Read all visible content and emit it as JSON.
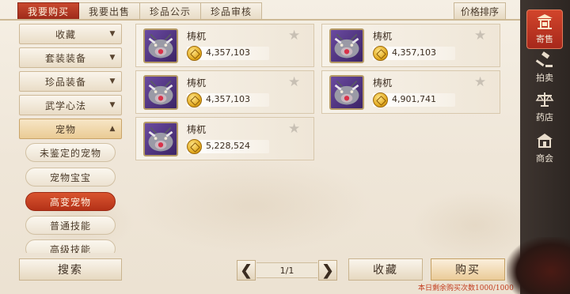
{
  "tabs": [
    {
      "label": "我要购买",
      "active": true
    },
    {
      "label": "我要出售",
      "active": false
    },
    {
      "label": "珍品公示",
      "active": false
    },
    {
      "label": "珍品审核",
      "active": false
    }
  ],
  "sort_label": "价格排序",
  "sidebar": {
    "categories": [
      {
        "label": "收藏",
        "expanded": false
      },
      {
        "label": "套装装备",
        "expanded": false
      },
      {
        "label": "珍品装备",
        "expanded": false
      },
      {
        "label": "武学心法",
        "expanded": false
      },
      {
        "label": "宠物",
        "expanded": true
      }
    ],
    "subcategories": [
      {
        "label": "未鉴定的宠物",
        "active": false
      },
      {
        "label": "宠物宝宝",
        "active": false
      },
      {
        "label": "高变宠物",
        "active": true
      },
      {
        "label": "普通技能",
        "active": false
      },
      {
        "label": "高级技能",
        "active": false
      }
    ]
  },
  "items": [
    {
      "name": "梼杌",
      "price": "4,357,103"
    },
    {
      "name": "梼杌",
      "price": "4,357,103"
    },
    {
      "name": "梼杌",
      "price": "4,357,103"
    },
    {
      "name": "梼杌",
      "price": "4,901,741"
    },
    {
      "name": "梼杌",
      "price": "5,228,524"
    }
  ],
  "bottom": {
    "search_label": "搜索",
    "page": "1/1",
    "favorite_label": "收藏",
    "buy_label": "购买",
    "remaining_text": "本日剩余购买次数1000/1000"
  },
  "rail": [
    {
      "label": "寄售",
      "icon": "pavilion-icon",
      "active": true
    },
    {
      "label": "拍卖",
      "icon": "gavel-icon",
      "active": false
    },
    {
      "label": "药店",
      "icon": "scale-icon",
      "active": false
    },
    {
      "label": "商会",
      "icon": "house-icon",
      "active": false
    }
  ],
  "colors": {
    "accent_red": "#b43218",
    "price_text": "#3a2c1f",
    "remaining_text": "#c23a1c"
  }
}
